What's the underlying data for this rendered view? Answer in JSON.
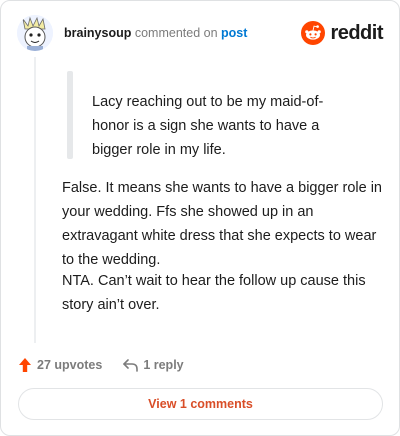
{
  "header": {
    "username": "brainysoup",
    "action_text": "commented on",
    "post_link": "post",
    "brand": "reddit"
  },
  "comment": {
    "quote": "Lacy reaching out to be my maid-of-honor is a sign she wants to have a bigger role in my life.",
    "paragraphs": [
      "False. It means she wants to have a bigger role in your wedding. Ffs she showed up in an extravagant white dress that she expects to wear to the wedding.",
      "NTA. Can’t wait to hear the follow up cause this story ain’t over."
    ]
  },
  "actions": {
    "upvotes": "27 upvotes",
    "replies": "1 reply"
  },
  "footer": {
    "view_comments": "View 1 comments"
  },
  "colors": {
    "accent": "#ff4500",
    "link": "#0079d3",
    "button_text": "#d94e28"
  }
}
